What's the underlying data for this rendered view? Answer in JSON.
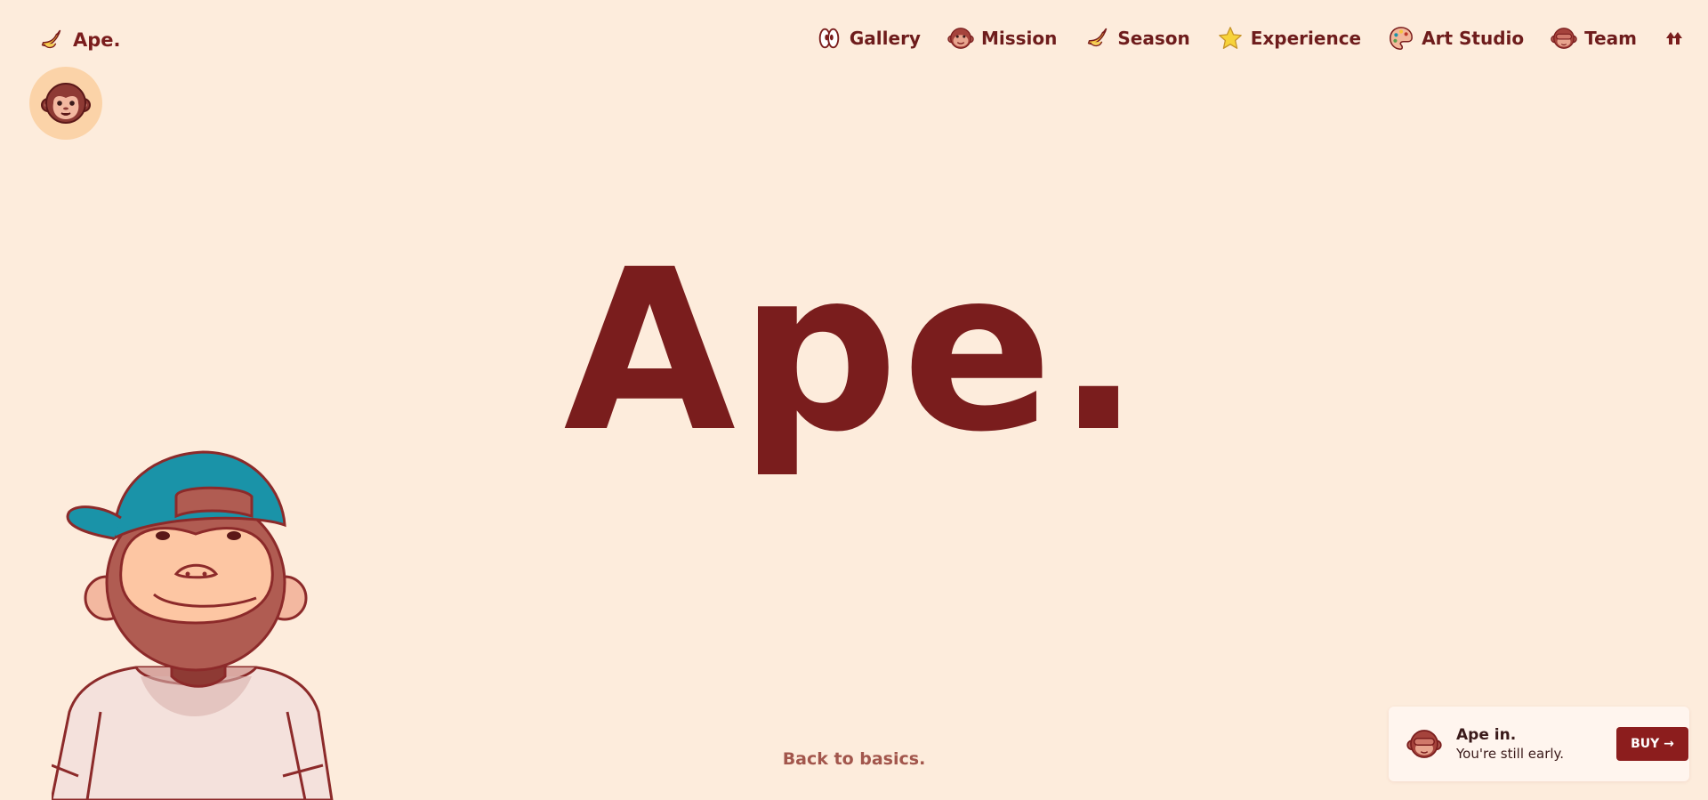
{
  "header": {
    "brand_label": "Ape.",
    "nav": [
      {
        "label": "Gallery",
        "icon": "eyes-icon"
      },
      {
        "label": "Mission",
        "icon": "monkey-face-icon"
      },
      {
        "label": "Season",
        "icon": "banana-icon"
      },
      {
        "label": "Experience",
        "icon": "star-icon"
      },
      {
        "label": "Art Studio",
        "icon": "palette-icon"
      },
      {
        "label": "Team",
        "icon": "see-no-evil-monkey-icon"
      }
    ],
    "end_icon": "double-arrow-up-icon"
  },
  "hero": {
    "title": "Ape.",
    "tagline": "Back to basics."
  },
  "buy_card": {
    "title": "Ape in.",
    "subtitle": "You're still early.",
    "button_label": "BUY →"
  },
  "colors": {
    "background": "#fdecdc",
    "primary": "#7a1d1d",
    "button": "#8c1d1d",
    "tagline": "#a2564c",
    "cap": "#1a93a8"
  }
}
